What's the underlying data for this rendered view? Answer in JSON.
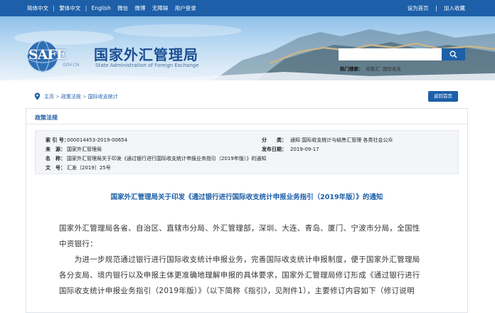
{
  "topbar": {
    "lang_links": [
      "简体中文",
      "繁体中文",
      "English"
    ],
    "social_links": [
      "微信",
      "微博",
      "无障碍",
      "用户登录"
    ],
    "right_links": [
      "设为首页",
      "加入收藏"
    ],
    "separator": "|"
  },
  "header": {
    "logo_text": "SAFE",
    "logo_domain": "GOV.CN",
    "site_title": "国家外汇管理局",
    "site_title_en": "State Administration of Foreign Exchange",
    "search_placeholder": "",
    "hot_label": "热门搜索：",
    "hot_terms": [
      "结售汇",
      "国际收支"
    ]
  },
  "breadcrumb": {
    "items": [
      "主页",
      "政策法规",
      "国际收支统计"
    ],
    "arrow": ">",
    "back_label": "返回首页"
  },
  "panel": {
    "title": "政策法规",
    "meta": {
      "index_label": "索 引 号：",
      "index_value": "000014453-2019-00654",
      "source_label": "来　源：",
      "source_value": "国家外汇管理局",
      "name_label": "名　称：",
      "name_value": "国家外汇管理局关于印发《通过银行进行国际收支统计申报业务指引（2019年版）》的通知",
      "docno_label": "文　号：",
      "docno_value": "汇发〔2019〕25号",
      "category_label": "分　　类：",
      "category_value": "通知  国际收支统计与结售汇管理  各类社会公众",
      "date_label": "发布日期：",
      "date_value": "2019-09-17"
    },
    "doc_title": "国家外汇管理局关于印发《通过银行进行国际收支统计申报业务指引（2019年版）》的通知",
    "paragraphs": [
      "国家外汇管理局各省、自治区、直辖市分局、外汇管理部，深圳、大连、青岛、厦门、宁波市分局，全国性",
      "中资银行：",
      "　　为进一步规范通过银行进行国际收支统计申报业务，完善国际收支统计申报制度，便于国家外汇管理局",
      "各分支局、境内银行以及申报主体更准确地理解申报的具体要求，国家外汇管理局修订形成《通过银行进行",
      "国际收支统计申报业务指引（2019年版）》（以下简称《指引》，见附件1），主要修订内容如下（修订说明"
    ]
  },
  "colors": {
    "brand_blue": "#1d5fa8",
    "title_blue": "#1b4f93",
    "meta_bg": "#f3f5f8"
  },
  "icons": [
    "location-pin-icon",
    "search-icon",
    "safe-logo-icon"
  ]
}
